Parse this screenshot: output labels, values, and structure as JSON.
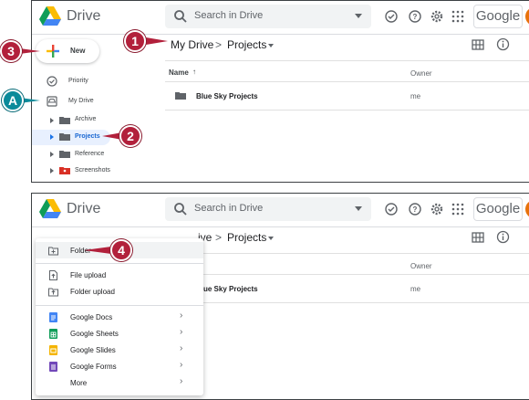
{
  "colors": {
    "callout_red": "#b2203b",
    "callout_teal": "#0b8a9a",
    "selected_bg": "#e8f0fe",
    "brand_gray": "#5f6368"
  },
  "panel1": {
    "brand": "Drive",
    "search_placeholder": "Search in Drive",
    "google": "Google",
    "breadcrumb": {
      "root": "My Drive",
      "sep": ">",
      "current": "Projects"
    },
    "list_header": {
      "name": "Name",
      "sort_arrow": "↑",
      "owner": "Owner"
    },
    "rows": [
      {
        "name": "Blue Sky Projects",
        "owner": "me"
      }
    ],
    "new_label": "New",
    "nav": {
      "priority": "Priority",
      "my_drive": "My Drive"
    },
    "folders": [
      "Archive",
      "Projects",
      "Reference",
      "Screenshots"
    ]
  },
  "panel2": {
    "brand": "Drive",
    "search_placeholder": "Search in Drive",
    "google": "Google",
    "breadcrumb": {
      "root_partial": "ive",
      "sep": ">",
      "current": "Projects"
    },
    "owner_header": "Owner",
    "row_partial": "ue Sky Projects",
    "row_owner": "me",
    "menu": {
      "folder": "Folder",
      "file_upload": "File upload",
      "folder_upload": "Folder upload",
      "docs": "Google Docs",
      "sheets": "Google Sheets",
      "slides": "Google Slides",
      "forms": "Google Forms",
      "more": "More",
      "chevron": "›"
    }
  },
  "callouts": {
    "one": "1",
    "two": "2",
    "three": "3",
    "four": "4",
    "a": "A"
  },
  "icons": [
    "drive-logo-icon",
    "search-icon",
    "offline-check-icon",
    "help-icon",
    "settings-gear-icon",
    "apps-grid-icon",
    "grid-view-icon",
    "info-icon",
    "folder-icon",
    "priority-icon",
    "my-drive-icon",
    "new-folder-icon",
    "file-upload-icon",
    "folder-upload-icon",
    "docs-icon",
    "sheets-icon",
    "slides-icon",
    "forms-icon"
  ]
}
